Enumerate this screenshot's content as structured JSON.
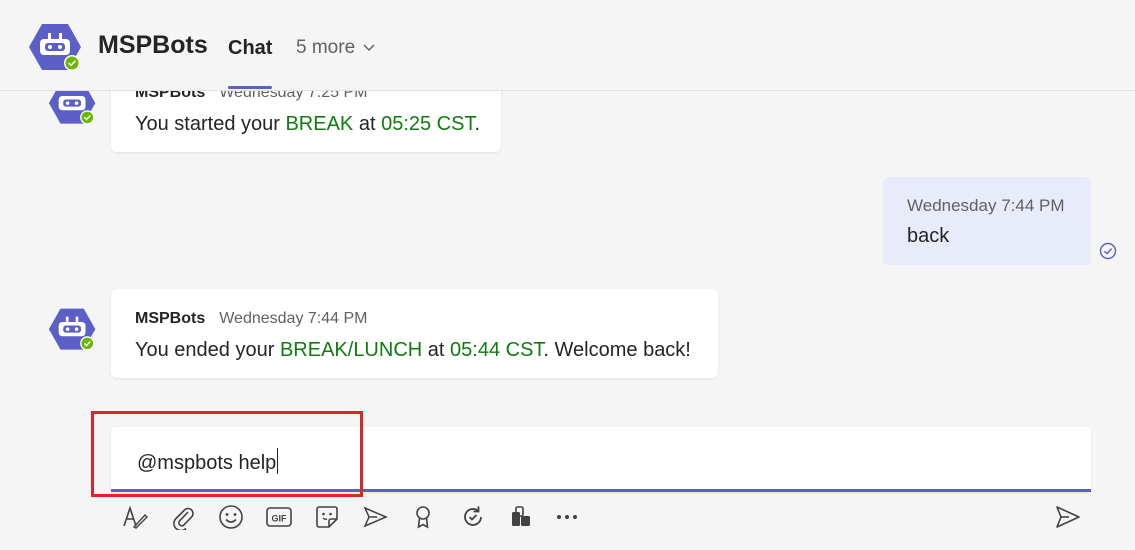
{
  "header": {
    "app_name": "MSPBots",
    "active_tab": "Chat",
    "more_tabs": "5 more"
  },
  "colors": {
    "accent": "#5b5fc7",
    "bot_avatar": "#5b5fc7",
    "status_available": "#6bb700",
    "highlight_text": "#107c10",
    "annotation_box": "#d9262c",
    "my_bubble": "#e8ebfa"
  },
  "messages": [
    {
      "sender": "MSPBots",
      "time": "Wednesday 7:25 PM",
      "parts": [
        "You started your ",
        "BREAK",
        " at ",
        "05:25 CST",
        "."
      ]
    },
    {
      "sender": "me",
      "time": "Wednesday 7:44 PM",
      "text": "back",
      "status_icon": "read-receipt-icon"
    },
    {
      "sender": "MSPBots",
      "time": "Wednesday 7:44 PM",
      "parts": [
        "You ended your ",
        "BREAK/LUNCH",
        " at ",
        "05:44 CST",
        ". Welcome back!"
      ]
    }
  ],
  "composer": {
    "value": "@mspbots help"
  },
  "toolbar": {
    "icons": [
      "format-icon",
      "attach-icon",
      "emoji-icon",
      "gif-icon",
      "sticker-icon",
      "schedule-meeting-icon",
      "praise-icon",
      "loop-icon",
      "apps-icon",
      "more-options-icon",
      "send-icon"
    ]
  }
}
